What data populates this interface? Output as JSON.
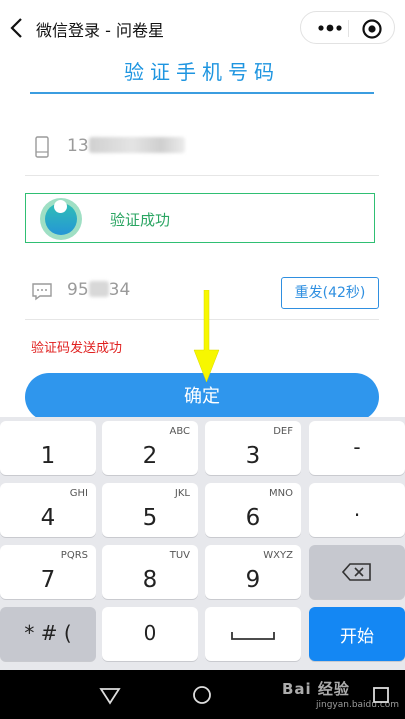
{
  "topbar": {
    "title": "微信登录 - 问卷星",
    "back_icon": "chevron-left-icon",
    "more_icon": "more-dots-icon",
    "close_icon": "mini-program-close-icon"
  },
  "form": {
    "heading": "验证手机号码",
    "phone": {
      "icon": "mobile-phone-icon",
      "value_prefix": "13"
    },
    "verification": {
      "status_text": "验证成功",
      "accent_color": "#2fbf73"
    },
    "sms_code": {
      "icon": "sms-message-icon",
      "value_prefix": "95",
      "value_suffix": "34"
    },
    "resend_label": "重发(42秒)",
    "sms_status": "验证码发送成功",
    "confirm_label": "确定"
  },
  "annotation": {
    "arrow_color": "#f7f700"
  },
  "keyboard": {
    "keys": [
      {
        "label": "1",
        "letters": ""
      },
      {
        "label": "2",
        "letters": "ABC"
      },
      {
        "label": "3",
        "letters": "DEF"
      },
      {
        "label": "-",
        "letters": ""
      },
      {
        "label": "4",
        "letters": "GHI"
      },
      {
        "label": "5",
        "letters": "JKL"
      },
      {
        "label": "6",
        "letters": "MNO"
      },
      {
        "label": ".",
        "letters": ""
      },
      {
        "label": "7",
        "letters": "PQRS"
      },
      {
        "label": "8",
        "letters": "TUV"
      },
      {
        "label": "9",
        "letters": "WXYZ"
      },
      {
        "label": "",
        "letters": "",
        "icon": "backspace-icon"
      },
      {
        "label": "* # (",
        "letters": ""
      },
      {
        "label": "0",
        "letters": ""
      },
      {
        "label": "",
        "letters": "",
        "icon": "space-bar-icon"
      },
      {
        "label": "开始",
        "letters": ""
      }
    ]
  },
  "system_nav": {
    "back_icon": "triangle-back-icon",
    "home_icon": "circle-home-icon",
    "recents_icon": "square-recents-icon"
  },
  "watermark": {
    "text": "Bai 经验",
    "sub": "jingyan.baidu.com"
  }
}
